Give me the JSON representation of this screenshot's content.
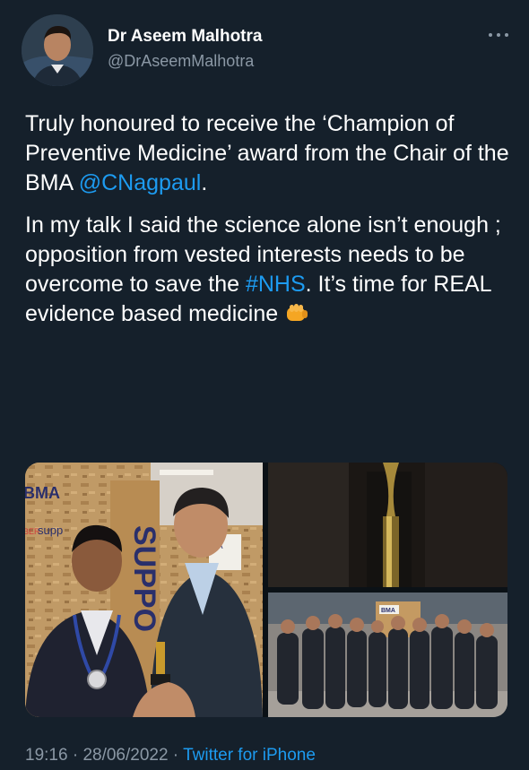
{
  "author": {
    "name": "Dr Aseem Malhotra",
    "handle": "@DrAseemMalhotra"
  },
  "tweet": {
    "p1": {
      "text": "Truly honoured to receive the ‘Champion of Preventive Medicine’ award from the Chair of the BMA ",
      "mention": "@CNagpaul",
      "end": "."
    },
    "p2": {
      "start": "In my talk I said the science alone isn’t enough ; opposition from vested interests needs to be overcome to save the ",
      "hashtag": "#NHS",
      "end": ". It’s time for REAL evidence based medicine "
    }
  },
  "media": {
    "left": {
      "bma_logo_text": "BMA",
      "banner_text": "supp",
      "banner_prefix": "BER",
      "vertical_text": "SUPPO",
      "board_text": "MA"
    },
    "bottom_right": {
      "board_text": "BMA"
    }
  },
  "footer": {
    "time": "19:16",
    "date": "28/06/2022",
    "separator": " · ",
    "source": "Twitter for iPhone"
  },
  "colors": {
    "background": "#15202b",
    "text": "#ffffff",
    "secondary": "#8b98a5",
    "link": "#1d9bf0",
    "fist_emoji": "#f5a623"
  }
}
